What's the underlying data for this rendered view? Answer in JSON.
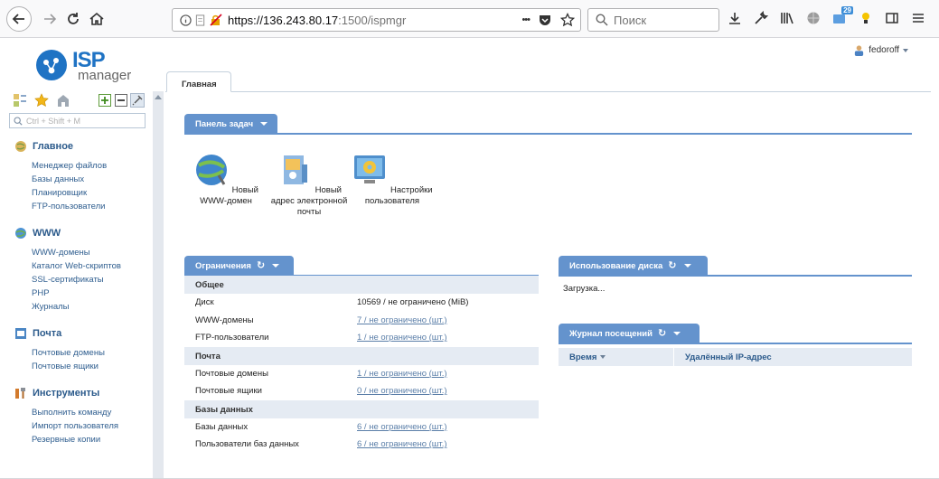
{
  "browser": {
    "url_host": "https://136.243.80.17",
    "url_rest": ":1500/ispmgr",
    "menu_dots": "•••",
    "search_placeholder": "Поиск",
    "badge_count": "29"
  },
  "logo": {
    "isp": "ISP",
    "manager": "manager"
  },
  "user": {
    "name": "fedoroff"
  },
  "sidebar": {
    "search_placeholder": "Ctrl + Shift + M",
    "groups": [
      {
        "label": "Главное",
        "icon": "globe-main-icon",
        "items": [
          "Менеджер файлов",
          "Базы данных",
          "Планировщик",
          "FTP-пользователи"
        ]
      },
      {
        "label": "WWW",
        "icon": "www-globe-icon",
        "items": [
          "WWW-домены",
          "Каталог Web-скриптов",
          "SSL-сертификаты",
          "PHP",
          "Журналы"
        ]
      },
      {
        "label": "Почта",
        "icon": "mail-box-icon",
        "items": [
          "Почтовые домены",
          "Почтовые ящики"
        ]
      },
      {
        "label": "Инструменты",
        "icon": "tools-icon",
        "items": [
          "Выполнить команду",
          "Импорт пользователя",
          "Резервные копии"
        ]
      }
    ]
  },
  "main": {
    "tab_label": "Главная",
    "tasks_panel": {
      "title": "Панель задач",
      "tasks": [
        {
          "label": "Новый WWW-домен",
          "icon": "new-www-domain-icon"
        },
        {
          "label": "Новый адрес электронной почты",
          "icon": "new-email-address-icon"
        },
        {
          "label": "Настройки пользователя",
          "icon": "user-settings-icon"
        }
      ]
    },
    "limits": {
      "title": "Ограничения",
      "sections": [
        {
          "title": "Общее",
          "rows": [
            {
              "key": "Диск",
              "value": "10569 / не ограничено (MiB)",
              "link": false
            },
            {
              "key": "WWW-домены",
              "value": "7 / не ограничено (шт.)",
              "link": true
            },
            {
              "key": "FTP-пользователи",
              "value": "1 / не ограничено (шт.)",
              "link": true
            }
          ]
        },
        {
          "title": "Почта",
          "rows": [
            {
              "key": "Почтовые домены",
              "value": "1 / не ограничено (шт.)",
              "link": true
            },
            {
              "key": "Почтовые ящики",
              "value": "0 / не ограничено (шт.)",
              "link": true
            }
          ]
        },
        {
          "title": "Базы данных",
          "rows": [
            {
              "key": "Базы данных",
              "value": "6 / не ограничено (шт.)",
              "link": true
            },
            {
              "key": "Пользователи баз данных",
              "value": "6 / не ограничено (шт.)",
              "link": true
            }
          ]
        }
      ]
    },
    "disk_usage": {
      "title": "Использование диска",
      "status": "Загрузка..."
    },
    "visit_log": {
      "title": "Журнал посещений",
      "col_time": "Время",
      "col_ip": "Удалённый IP-адрес"
    }
  },
  "colors": {
    "accent": "#6493cd",
    "link": "#2f5e8f",
    "section_bg": "#e5ebf3",
    "brand": "#1f73c4"
  }
}
